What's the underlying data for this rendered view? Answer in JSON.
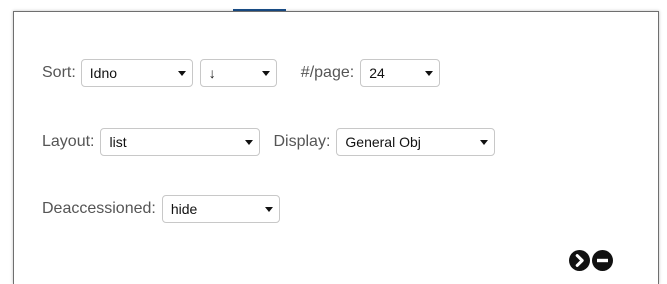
{
  "sort": {
    "label": "Sort:",
    "field_value": "Idno",
    "direction_value": "↓"
  },
  "per_page": {
    "label": "#/page:",
    "value": "24"
  },
  "layout": {
    "label": "Layout:",
    "value": "list"
  },
  "display": {
    "label": "Display:",
    "value": "General Obj"
  },
  "deaccessioned": {
    "label": "Deaccessioned:",
    "value": "hide"
  },
  "actions": {
    "next_icon": "chevron-right-circle-icon",
    "close_icon": "minus-circle-icon"
  },
  "colors": {
    "panel_border": "#6f6f6f",
    "label_text": "#555555",
    "button_fill": "#111111",
    "tab_accent": "#1a4f8b"
  }
}
